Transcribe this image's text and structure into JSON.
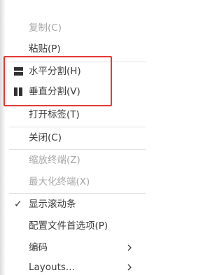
{
  "menu": {
    "copy": "复制(C)",
    "paste": "粘贴(P)",
    "split_horizontal": "水平分割(H)",
    "split_vertical": "垂直分割(V)",
    "open_tab": "打开标签(T)",
    "close": "关闭(C)",
    "zoom_out_terminal": "缩放终端(Z)",
    "maximize_terminal": "最大化终端(X)",
    "show_scrollbar": "显示滚动条",
    "show_scrollbar_checked": "✓",
    "preferences": "配置文件首选项(P)",
    "encoding": "编码",
    "layouts": "Layouts..."
  },
  "icons": {
    "split_horizontal": "split-horizontal-icon",
    "split_vertical": "split-vertical-icon",
    "submenu": "chevron-right-icon",
    "checked": "checkmark-icon"
  },
  "colors": {
    "highlight_border": "#e53935",
    "disabled_text": "#a8a8a8",
    "text": "#3c3c3c"
  }
}
